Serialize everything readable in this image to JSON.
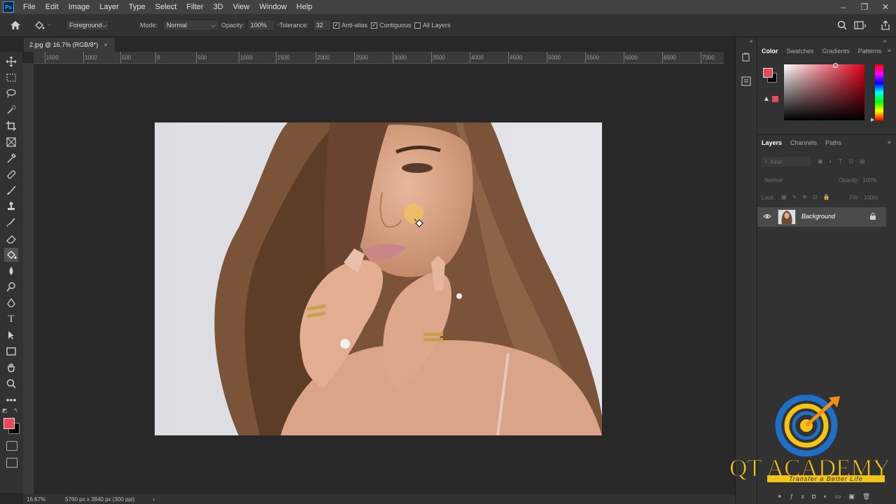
{
  "app": {
    "logo_text": "Ps"
  },
  "menu": [
    "File",
    "Edit",
    "Image",
    "Layer",
    "Type",
    "Select",
    "Filter",
    "3D",
    "View",
    "Window",
    "Help"
  ],
  "window_controls": [
    "–",
    "❐",
    "✕"
  ],
  "options_bar": {
    "fill_source": "Foreground",
    "mode_label": "Mode:",
    "mode_value": "Normal",
    "opacity_label": "Opacity:",
    "opacity_value": "100%",
    "tolerance_label": "Tolerance:",
    "tolerance_value": "32",
    "anti_alias_label": "Anti-alias",
    "contiguous_label": "Contiguous",
    "all_layers_label": "All Layers"
  },
  "document_tab": {
    "title": "2.jpg @ 16.7% (RGB/8*)",
    "close": "×"
  },
  "ruler_h_labels": [
    "1500",
    "1000",
    "500",
    "0",
    "500",
    "1000",
    "1500",
    "2000",
    "2500",
    "3000",
    "3500",
    "4000",
    "4500",
    "5000",
    "5500",
    "6000",
    "6500",
    "7000"
  ],
  "status": {
    "zoom": "16.67%",
    "doc_info": "5760 px x 3840 px (300 ppi)",
    "arrow": "›"
  },
  "panels": {
    "color_tabs": [
      "Color",
      "Swatches",
      "Gradients",
      "Patterns"
    ],
    "layers_tabs": [
      "Layers",
      "Channels",
      "Paths"
    ],
    "layers_search_placeholder": "Kind",
    "blend_mode": "Normal",
    "opacity_label": "Opacity:",
    "opacity_value": "100%",
    "lock_label": "Lock:",
    "fill_label": "Fill:",
    "fill_value": "100%",
    "layer_name": "Background"
  },
  "colors": {
    "foreground": "#e8475e",
    "background": "#000000",
    "accent": "#31a8ff"
  },
  "watermark": {
    "title": "QT ACADEMY",
    "tagline": "Transfer a Better Life"
  },
  "icons": [
    "home-icon",
    "paint-bucket-icon",
    "move-icon",
    "marquee-icon",
    "lasso-icon",
    "quick-select-icon",
    "crop-icon",
    "frame-icon",
    "eyedropper-icon",
    "healing-icon",
    "brush-icon",
    "stamp-icon",
    "history-brush-icon",
    "eraser-icon",
    "paint-bucket-tool-icon",
    "blur-icon",
    "dodge-icon",
    "pen-icon",
    "type-icon",
    "path-select-icon",
    "rectangle-icon",
    "hand-icon",
    "zoom-icon",
    "more-icon",
    "search-icon",
    "workspace-icon",
    "share-icon",
    "eye-icon",
    "lock-icon"
  ]
}
